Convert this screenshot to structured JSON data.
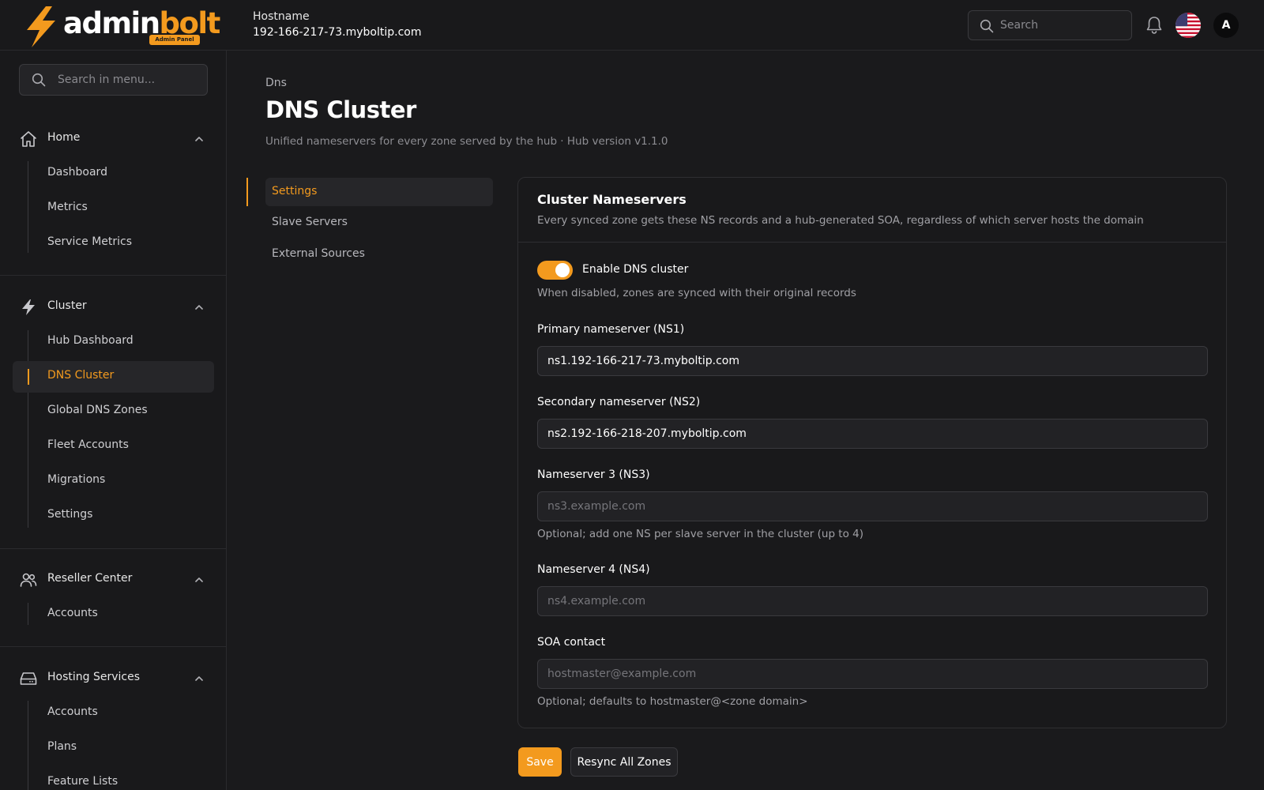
{
  "brand": {
    "logo_word_white": "admin",
    "logo_word_orange": "bolt",
    "badge": "Admin Panel",
    "accent_color": "#f39a1e"
  },
  "header": {
    "hostname_label": "Hostname",
    "hostname_value": "192-166-217-73.myboltip.com",
    "search_placeholder": "Search",
    "avatar_initial": "A",
    "icons": [
      "search-icon",
      "bell-icon",
      "us-flag-icon"
    ]
  },
  "sidebar": {
    "search_placeholder": "Search in menu...",
    "groups": [
      {
        "label": "Home",
        "icon": "home-icon",
        "items": [
          "Dashboard",
          "Metrics",
          "Service Metrics"
        ]
      },
      {
        "label": "Cluster",
        "icon": "bolt-icon",
        "items": [
          "Hub Dashboard",
          "DNS Cluster",
          "Global DNS Zones",
          "Fleet Accounts",
          "Migrations",
          "Settings"
        ]
      },
      {
        "label": "Reseller Center",
        "icon": "users-icon",
        "items": [
          "Accounts"
        ]
      },
      {
        "label": "Hosting Services",
        "icon": "server-icon",
        "items": [
          "Accounts",
          "Plans",
          "Feature Lists"
        ]
      }
    ],
    "active_item": "DNS Cluster"
  },
  "page": {
    "breadcrumb": "Dns",
    "title": "DNS Cluster",
    "subtitle": "Unified nameservers for every zone served by the hub · Hub version v1.1.0"
  },
  "subnav": {
    "items": [
      "Settings",
      "Slave Servers",
      "External Sources"
    ],
    "active": "Settings"
  },
  "card": {
    "title": "Cluster Nameservers",
    "description": "Every synced zone gets these NS records and a hub-generated SOA, regardless of which server hosts the domain",
    "toggle_label": "Enable DNS cluster",
    "toggle_on": true,
    "toggle_hint": "When disabled, zones are synced with their original records",
    "fields": [
      {
        "label": "Primary nameserver (NS1)",
        "value": "ns1.192-166-217-73.myboltip.com",
        "placeholder": "",
        "hint": ""
      },
      {
        "label": "Secondary nameserver (NS2)",
        "value": "ns2.192-166-218-207.myboltip.com",
        "placeholder": "",
        "hint": ""
      },
      {
        "label": "Nameserver 3 (NS3)",
        "value": "",
        "placeholder": "ns3.example.com",
        "hint": "Optional; add one NS per slave server in the cluster (up to 4)"
      },
      {
        "label": "Nameserver 4 (NS4)",
        "value": "",
        "placeholder": "ns4.example.com",
        "hint": ""
      },
      {
        "label": "SOA contact",
        "value": "",
        "placeholder": "hostmaster@example.com",
        "hint": "Optional; defaults to hostmaster@<zone domain>"
      }
    ]
  },
  "actions": {
    "save_label": "Save",
    "resync_label": "Resync All Zones"
  }
}
